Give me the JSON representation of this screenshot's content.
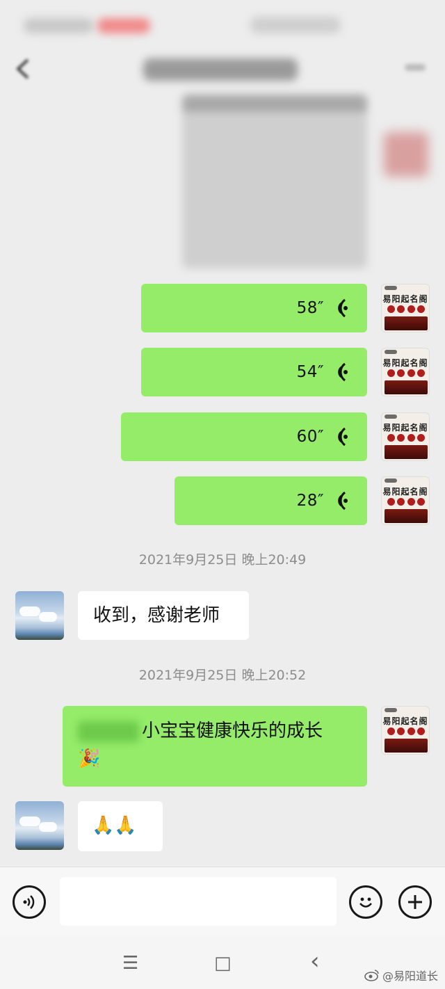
{
  "messages_sent_voice": [
    {
      "duration": "58″"
    },
    {
      "duration": "54″"
    },
    {
      "duration": "60″"
    },
    {
      "duration": "28″"
    }
  ],
  "avatar_me": {
    "label": "易阳起名阁"
  },
  "timestamps": [
    "2021年9月25日 晚上20:49",
    "2021年9月25日 晚上20:52"
  ],
  "friend_reply_1": "收到，感谢老师",
  "my_message": {
    "text": "小宝宝健康快乐的成长",
    "emoji": "🎉"
  },
  "friend_reply_2": "🙏🙏",
  "input_bar": {
    "voice_icon": "voice-icon",
    "emoji_icon": "smile-icon",
    "add_icon": "plus-icon"
  },
  "system_nav": {
    "menu": "☰",
    "home": "□",
    "back": "‹"
  },
  "watermark": "@易阳道长",
  "colors": {
    "bubble_green": "#95ec69",
    "background": "#ededed"
  }
}
